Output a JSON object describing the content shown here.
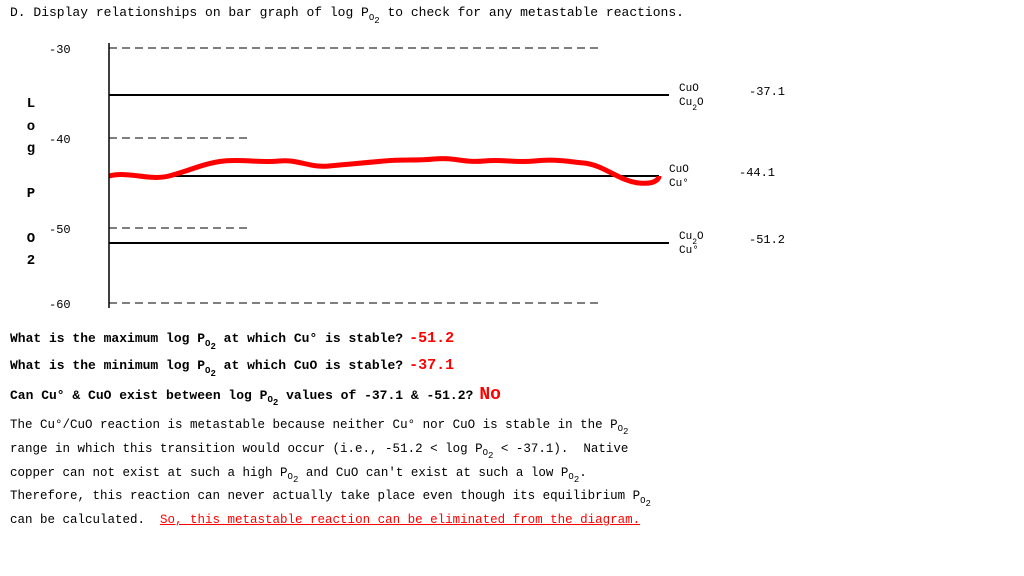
{
  "header": {
    "text": "D.  Display relationships on bar graph of log P"
  },
  "header_sub": "O2",
  "header_rest": " to check for any metastable reactions.",
  "chart": {
    "y_axis_letters": [
      "L",
      "o",
      "g",
      "",
      "P",
      "",
      "O",
      "2"
    ],
    "grid_lines": [
      {
        "label": "-30",
        "y_pct": 5
      },
      {
        "label": "-40",
        "y_pct": 38
      },
      {
        "label": "-50",
        "y_pct": 65
      },
      {
        "label": "-60",
        "y_pct": 92
      }
    ],
    "solid_lines": [
      {
        "y_pct": 22,
        "label_left": "CuO",
        "label_left2": "Cu₂O",
        "value": "-37.1",
        "label_right_top": "CuO",
        "label_right_bottom": "Cu₂O"
      },
      {
        "y_pct": 52,
        "value": "-44.1",
        "label_right_top": "CuO",
        "label_right_bottom": "Cu°"
      },
      {
        "y_pct": 72,
        "value": "-51.2",
        "label_right_top": "Cu₂O",
        "label_right_bottom": "Cu°"
      }
    ]
  },
  "questions": [
    {
      "text": "What is the maximum log P",
      "sub": "O2",
      "text2": " at which Cu° is stable?",
      "answer": "-51.2"
    },
    {
      "text": "What is the minimum log P",
      "sub": "O2",
      "text2": " at which CuO is stable?",
      "answer": "-37.1"
    },
    {
      "text": "Can Cu° & CuO exist between log P",
      "sub": "O2",
      "text2": " values of -37.1 & -51.2?",
      "answer": "No"
    }
  ],
  "prose": {
    "lines": [
      "The Cu°/CuO reaction is metastable because neither Cu° nor CuO is stable in the P",
      "range in which this transition would occur (i.e., -51.2 < log P",
      "copper can not exist at such a high P",
      "Therefore, this reaction can never actually take place even though its equilibrium P",
      "can be calculated."
    ],
    "link_text": "So, this metastable reaction can be eliminated from the diagram."
  }
}
